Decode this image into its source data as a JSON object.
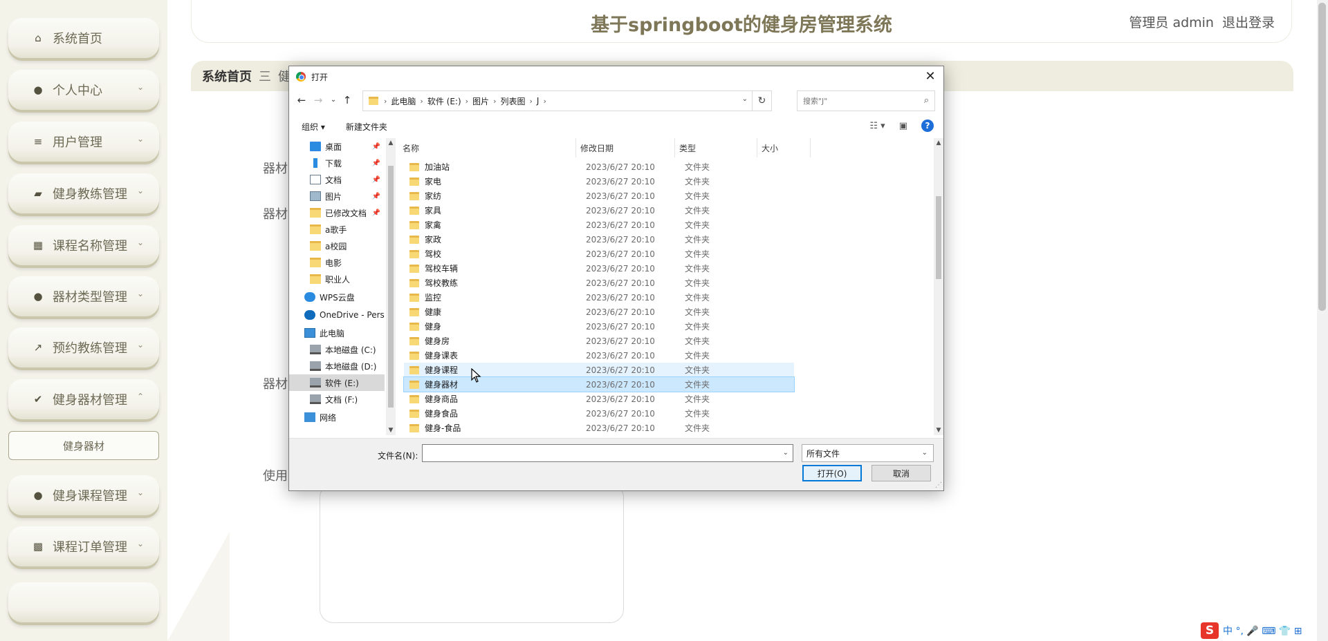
{
  "app": {
    "title": "基于springboot的健身房管理系统",
    "user_label": "管理员 admin",
    "logout_label": "退出登录"
  },
  "sidebar": {
    "items": [
      {
        "label": "系统首页",
        "icon": "home-icon",
        "expandable": false
      },
      {
        "label": "个人中心",
        "icon": "user-icon",
        "expandable": true
      },
      {
        "label": "用户管理",
        "icon": "list-icon",
        "expandable": true
      },
      {
        "label": "健身教练管理",
        "icon": "wallet-icon",
        "expandable": true
      },
      {
        "label": "课程名称管理",
        "icon": "grid-icon",
        "expandable": true
      },
      {
        "label": "器材类型管理",
        "icon": "user-icon",
        "expandable": true
      },
      {
        "label": "预约教练管理",
        "icon": "chart-icon",
        "expandable": true
      },
      {
        "label": "健身器材管理",
        "icon": "check-icon",
        "expandable": true,
        "expanded": true
      },
      {
        "label": "健身课程管理",
        "icon": "bulb-icon",
        "expandable": true
      },
      {
        "label": "课程订单管理",
        "icon": "apps-icon",
        "expandable": true
      }
    ],
    "submenu_item": "健身器材"
  },
  "breadcrumb": {
    "home": "系统首页",
    "sep": "三",
    "current": "健身"
  },
  "form": {
    "label1": "器材",
    "label2": "器材",
    "label3": "器材",
    "label4": "使用"
  },
  "dialog": {
    "title": "打开",
    "address": [
      "此电脑",
      "软件 (E:)",
      "图片",
      "列表图",
      "J"
    ],
    "search_placeholder": "搜索\"J\"",
    "toolbar": {
      "organize": "组织 ▾",
      "new_folder": "新建文件夹"
    },
    "nav_items": [
      {
        "label": "桌面",
        "icon": "desktop-icon",
        "pinned": true
      },
      {
        "label": "下载",
        "icon": "download-icon",
        "pinned": true
      },
      {
        "label": "文档",
        "icon": "document-icon",
        "pinned": true
      },
      {
        "label": "图片",
        "icon": "picture-icon",
        "pinned": true
      },
      {
        "label": "已修改文档",
        "icon": "folder-icon",
        "pinned": true
      },
      {
        "label": "a歌手",
        "icon": "folder-icon",
        "pinned": false
      },
      {
        "label": "a校园",
        "icon": "folder-icon",
        "pinned": false
      },
      {
        "label": "电影",
        "icon": "folder-icon",
        "pinned": false
      },
      {
        "label": "职业人",
        "icon": "folder-icon",
        "pinned": false
      },
      {
        "label": "WPS云盘",
        "icon": "cloud-icon",
        "pinned": false
      },
      {
        "label": "OneDrive - Pers",
        "icon": "onedrive-icon",
        "pinned": false
      },
      {
        "label": "此电脑",
        "icon": "computer-icon",
        "pinned": false
      },
      {
        "label": "本地磁盘 (C:)",
        "icon": "drive-icon",
        "pinned": false
      },
      {
        "label": "本地磁盘 (D:)",
        "icon": "drive-icon",
        "pinned": false
      },
      {
        "label": "软件 (E:)",
        "icon": "drive-icon",
        "pinned": false,
        "selected": true
      },
      {
        "label": "文档 (F:)",
        "icon": "drive-icon",
        "pinned": false
      },
      {
        "label": "网络",
        "icon": "network-icon",
        "pinned": false
      }
    ],
    "columns": {
      "name": "名称",
      "date": "修改日期",
      "type": "类型",
      "size": "大小"
    },
    "files": [
      {
        "name": "加油站",
        "date": "2023/6/27 20:10",
        "type": "文件夹"
      },
      {
        "name": "家电",
        "date": "2023/6/27 20:10",
        "type": "文件夹"
      },
      {
        "name": "家纺",
        "date": "2023/6/27 20:10",
        "type": "文件夹"
      },
      {
        "name": "家具",
        "date": "2023/6/27 20:10",
        "type": "文件夹"
      },
      {
        "name": "家禽",
        "date": "2023/6/27 20:10",
        "type": "文件夹"
      },
      {
        "name": "家政",
        "date": "2023/6/27 20:10",
        "type": "文件夹"
      },
      {
        "name": "驾校",
        "date": "2023/6/27 20:10",
        "type": "文件夹"
      },
      {
        "name": "驾校车辆",
        "date": "2023/6/27 20:10",
        "type": "文件夹"
      },
      {
        "name": "驾校教练",
        "date": "2023/6/27 20:10",
        "type": "文件夹"
      },
      {
        "name": "监控",
        "date": "2023/6/27 20:10",
        "type": "文件夹"
      },
      {
        "name": "健康",
        "date": "2023/6/27 20:10",
        "type": "文件夹"
      },
      {
        "name": "健身",
        "date": "2023/6/27 20:10",
        "type": "文件夹"
      },
      {
        "name": "健身房",
        "date": "2023/6/27 20:10",
        "type": "文件夹"
      },
      {
        "name": "健身课表",
        "date": "2023/6/27 20:10",
        "type": "文件夹"
      },
      {
        "name": "健身课程",
        "date": "2023/6/27 20:10",
        "type": "文件夹",
        "state": "hover"
      },
      {
        "name": "健身器材",
        "date": "2023/6/27 20:10",
        "type": "文件夹",
        "state": "selected"
      },
      {
        "name": "健身商品",
        "date": "2023/6/27 20:10",
        "type": "文件夹"
      },
      {
        "name": "健身食品",
        "date": "2023/6/27 20:10",
        "type": "文件夹"
      },
      {
        "name": "健身-食品",
        "date": "2023/6/27 20:10",
        "type": "文件夹"
      }
    ],
    "filename_label": "文件名(N):",
    "filename_value": "",
    "filetype_value": "所有文件",
    "open_label": "打开(O)",
    "cancel_label": "取消"
  },
  "taskbar": {
    "ime_logo": "S",
    "ime_text": "中 °, 🎤 ⌨ 👕 ⊞"
  },
  "colors": {
    "accent": "#7d7657",
    "sidebar_bg": "#f4f3ea",
    "selection": "#cce8ff",
    "primary_button": "#0078d7"
  }
}
